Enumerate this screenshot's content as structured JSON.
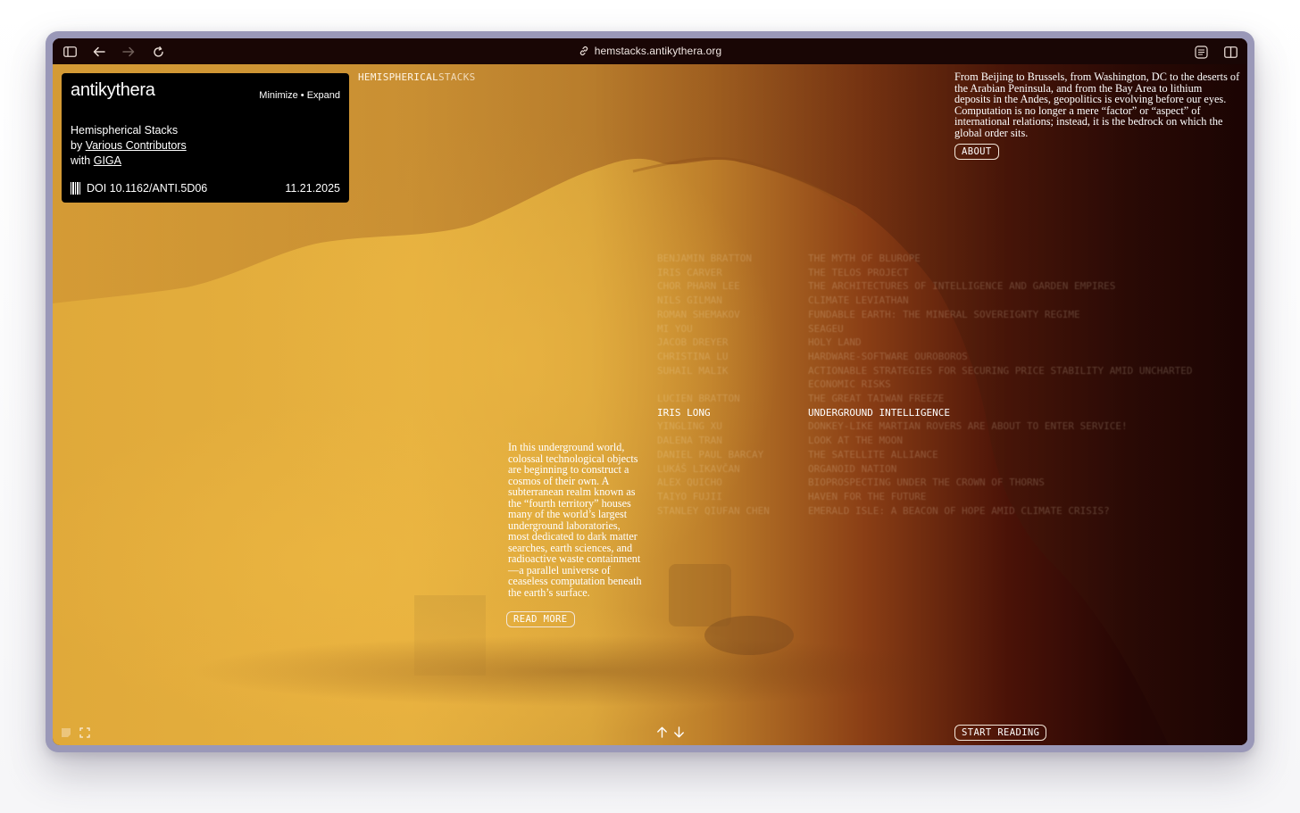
{
  "browser": {
    "url": "hemstacks.antikythera.org"
  },
  "panel": {
    "brand": "antikythera",
    "minimize": "Minimize",
    "separator": "•",
    "expand": "Expand",
    "title": "Hemispherical Stacks",
    "by_prefix": "by",
    "contributors": "Various Contributors",
    "with_prefix": "with",
    "partner": "GIGA",
    "doi": "DOI 10.1162/ANTI.5D06",
    "date": "11.21.2025"
  },
  "site_title": {
    "part1": "HEMISPHERICAL",
    "part2": "STACKS"
  },
  "about": {
    "text": "From Beijing to Brussels, from Washington, DC to the deserts of the Arabian Peninsula, and from the Bay Area to lithium deposits in the Andes, geopolitics is evolving before our eyes. Computation is no longer a mere “factor” or “aspect” of international relations; instead, it is the bedrock on which the global order sits.",
    "button": "ABOUT"
  },
  "articles": [
    {
      "author": "BENJAMIN BRATTON",
      "title": "THE MYTH OF BLUROPE"
    },
    {
      "author": "IRIS CARVER",
      "title": "THE TELOS PROJECT"
    },
    {
      "author": "CHOR PHARN LEE",
      "title": "THE ARCHITECTURES OF INTELLIGENCE AND GARDEN EMPIRES"
    },
    {
      "author": "NILS GILMAN",
      "title": "CLIMATE LEVIATHAN"
    },
    {
      "author": "ROMAN SHEMAKOV",
      "title": "FUNDABLE EARTH: THE MINERAL SOVEREIGNTY REGIME"
    },
    {
      "author": "MI YOU",
      "title": "SEAGEU"
    },
    {
      "author": "JACOB DREYER",
      "title": "HOLY LAND"
    },
    {
      "author": "CHRISTINA LU",
      "title": "HARDWARE-SOFTWARE OUROBOROS"
    },
    {
      "author": "SUHAIL MALIK",
      "title": "ACTIONABLE STRATEGIES FOR SECURING PRICE STABILITY AMID UNCHARTED ECONOMIC RISKS"
    },
    {
      "author": "LUCIEN BRATTON",
      "title": "THE GREAT TAIWAN FREEZE"
    },
    {
      "author": "IRIS LONG",
      "title": "UNDERGROUND INTELLIGENCE",
      "active": true
    },
    {
      "author": "YINGLING XU",
      "title": "DONKEY-LIKE MARTIAN ROVERS ARE ABOUT TO ENTER SERVICE!"
    },
    {
      "author": "DALENA TRAN",
      "title": "LOOK AT THE MOON"
    },
    {
      "author": "DANIEL PAUL BARCAY",
      "title": "THE SATELLITE ALLIANCE"
    },
    {
      "author": "LUKÁŠ LIKAVČAN",
      "title": "ORGANOID NATION"
    },
    {
      "author": "ALEX QUICHO",
      "title": "BIOPROSPECTING UNDER THE CROWN OF THORNS"
    },
    {
      "author": "TAIYO FUJII",
      "title": "HAVEN FOR THE FUTURE"
    },
    {
      "author": "STANLEY QIUFAN CHEN",
      "title": "EMERALD ISLE: A BEACON OF HOPE AMID CLIMATE CRISIS?"
    }
  ],
  "excerpt": {
    "text": "In this underground world, colossal technological objects are beginning to construct a cosmos of their own. A subterranean realm known as the “fourth territory” houses many of the world’s largest underground laboratories, most dedicated to dark matter searches, earth sciences, and radioactive waste containment—a parallel universe of ceaseless computation beneath the earth’s surface.",
    "button": "READ MORE"
  },
  "footer": {
    "start_reading": "START READING"
  },
  "colors": {
    "gold": "#e6b13f",
    "deep": "#1a0403",
    "accent": "#ffffff"
  }
}
